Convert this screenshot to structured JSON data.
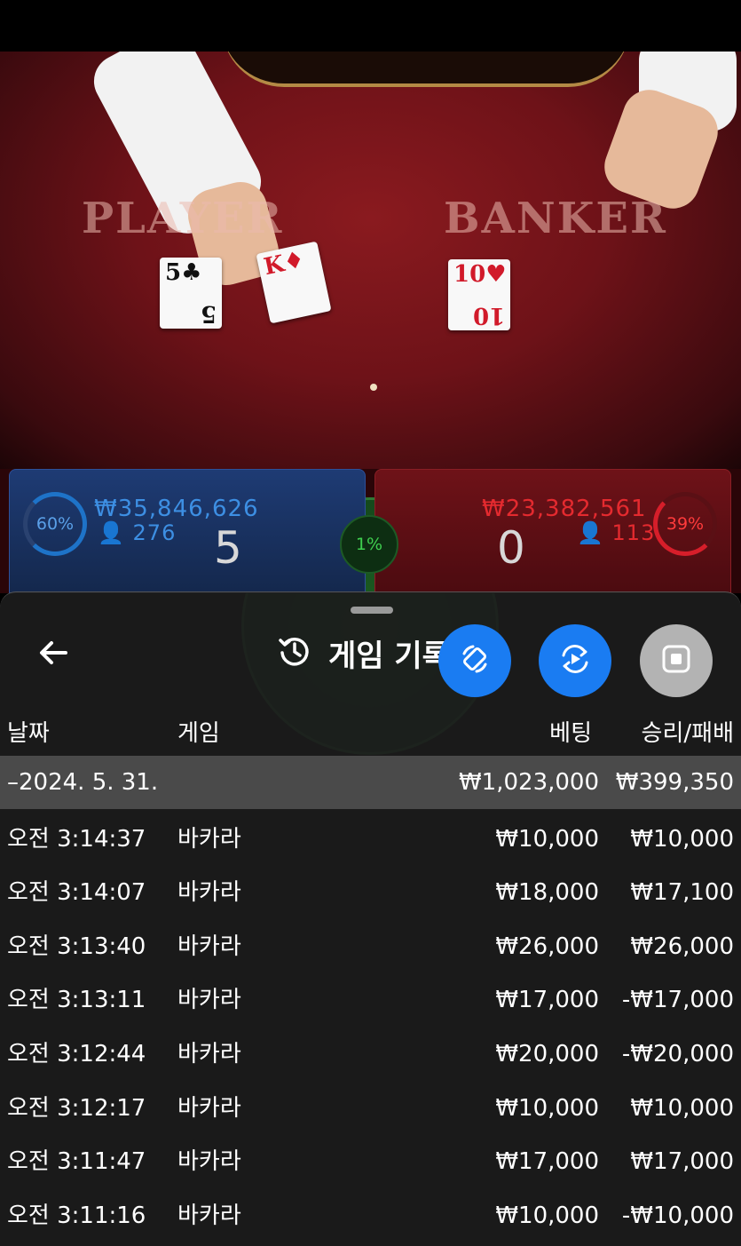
{
  "table": {
    "player_label": "PLAYER",
    "banker_label": "BANKER",
    "player_card_1": "5",
    "player_card_1_suit": "♣",
    "player_card_2": "K",
    "player_card_2_suit": "♦",
    "banker_card_1": "10",
    "banker_card_1_suit": "♥"
  },
  "player_panel": {
    "percent": "60%",
    "amount": "₩35,846,626",
    "players": "276",
    "score": "5",
    "color": "#1e73c8"
  },
  "banker_panel": {
    "percent": "39%",
    "amount": "₩23,382,561",
    "players": "113",
    "score": "0",
    "color": "#d61e2a"
  },
  "tie_panel": {
    "percent": "1%",
    "color": "#3fcf4f"
  },
  "history": {
    "title": "게임 기록",
    "back_icon": "arrow-left-icon",
    "title_icon": "history-icon",
    "buttons": [
      {
        "name": "rotate-screen-button",
        "icon": "rotate-icon",
        "color": "#1a7cf2"
      },
      {
        "name": "replay-button",
        "icon": "replay-icon",
        "color": "#1a7cf2"
      },
      {
        "name": "stop-button",
        "icon": "stop-icon",
        "color": "#b3b3b3"
      }
    ],
    "columns": {
      "date": "날짜",
      "game": "게임",
      "bet": "베팅",
      "result": "승리/패배"
    },
    "summary": {
      "date": "–2024. 5. 31.",
      "bet": "₩1,023,000",
      "result": "₩399,350"
    },
    "rows": [
      {
        "time": "오전 3:14:37",
        "game": "바카라",
        "bet": "₩10,000",
        "result": "₩10,000"
      },
      {
        "time": "오전 3:14:07",
        "game": "바카라",
        "bet": "₩18,000",
        "result": "₩17,100"
      },
      {
        "time": "오전 3:13:40",
        "game": "바카라",
        "bet": "₩26,000",
        "result": "₩26,000"
      },
      {
        "time": "오전 3:13:11",
        "game": "바카라",
        "bet": "₩17,000",
        "result": "-₩17,000"
      },
      {
        "time": "오전 3:12:44",
        "game": "바카라",
        "bet": "₩20,000",
        "result": "-₩20,000"
      },
      {
        "time": "오전 3:12:17",
        "game": "바카라",
        "bet": "₩10,000",
        "result": "₩10,000"
      },
      {
        "time": "오전 3:11:47",
        "game": "바카라",
        "bet": "₩17,000",
        "result": "₩17,000"
      },
      {
        "time": "오전 3:11:16",
        "game": "바카라",
        "bet": "₩10,000",
        "result": "-₩10,000"
      }
    ]
  }
}
